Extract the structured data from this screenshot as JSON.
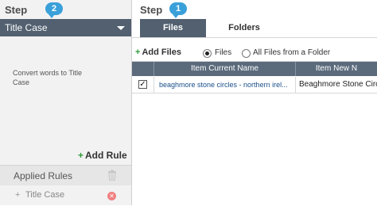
{
  "left_panel": {
    "step_label": "Step",
    "step_number": "2",
    "selected_rule": "Title Case",
    "description": "Convert words to Title Case",
    "add_rule_label": "Add Rule",
    "applied_rules_title": "Applied Rules",
    "applied_rules": [
      {
        "label": "Title Case"
      }
    ]
  },
  "right_panel": {
    "step_label": "Step",
    "step_number": "1",
    "tabs": [
      {
        "label": "Files",
        "active": true
      },
      {
        "label": "Folders",
        "active": false
      }
    ],
    "add_files_label": "Add Files",
    "radio_files_label": "Files",
    "radio_all_label": "All Files from a Folder",
    "selected_radio": "Files",
    "table": {
      "columns": [
        "Item Current Name",
        "Item New N"
      ],
      "rows": [
        {
          "checked": true,
          "current_name": "beaghmore stone circles - northern irel...",
          "new_name": "Beaghmore Stone Circ"
        }
      ]
    }
  },
  "colors": {
    "accent": "#526070",
    "step_badge": "#3aa0d9",
    "add_green": "#2f9a3a"
  },
  "icons": {
    "add": "plus-icon",
    "delete": "trash-icon",
    "remove": "remove-icon",
    "dropdown": "chevron-down-icon",
    "check": "checkmark-icon"
  }
}
